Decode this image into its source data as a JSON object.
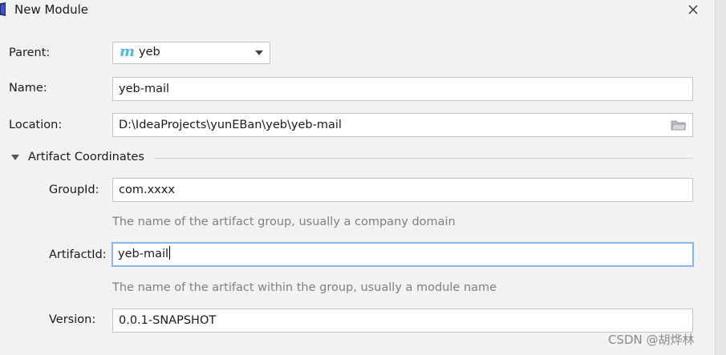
{
  "dialog": {
    "title": "New Module",
    "icons": {
      "app": "app-logo-icon",
      "close": "close-icon"
    }
  },
  "form": {
    "parent": {
      "label": "Parent:",
      "value": "yeb",
      "icon": "maven-module-icon"
    },
    "name": {
      "label": "Name:",
      "value": "yeb-mail"
    },
    "location": {
      "label": "Location:",
      "value": "D:\\IdeaProjects\\yunEBan\\yeb\\yeb-mail",
      "icon": "folder-icon"
    },
    "artifact_section": {
      "title": "Artifact Coordinates",
      "expanded": true,
      "group_id": {
        "label": "GroupId:",
        "value": "com.xxxx",
        "hint": "The name of the artifact group, usually a company domain"
      },
      "artifact_id": {
        "label": "ArtifactId:",
        "value": "yeb-mail",
        "hint": "The name of the artifact within the group, usually a module name",
        "focused": true
      },
      "version": {
        "label": "Version:",
        "value": "0.0.1-SNAPSHOT"
      }
    }
  },
  "watermark": "CSDN @胡烨林",
  "colors": {
    "background": "#f2f2f2",
    "field_border": "#c4c4c4",
    "focus_border": "#8ab4e8",
    "hint_text": "#808080",
    "maven_icon": "#4fb6e0"
  }
}
